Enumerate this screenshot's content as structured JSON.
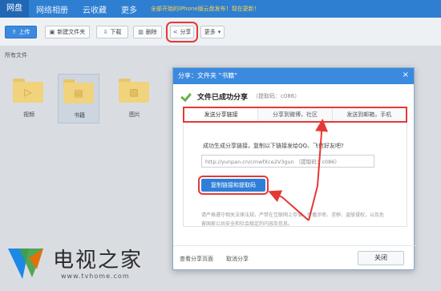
{
  "topbar": {
    "brand": "网盘",
    "nav": [
      "网络相册",
      "云收藏",
      "更多"
    ],
    "promo": "全部开始的iPhone版云盘发布！现在更新！"
  },
  "toolbar": {
    "upload": "上传",
    "new_folder": "新建文件夹",
    "download": "下载",
    "delete": "删除",
    "share": "分享",
    "more": "更多"
  },
  "breadcrumb": "所有文件",
  "files": [
    {
      "name": "视频",
      "icon": "play-icon"
    },
    {
      "name": "书籍",
      "icon": "book-icon"
    },
    {
      "name": "图片",
      "icon": "image-icon"
    }
  ],
  "dialog": {
    "title": "分享：文件夹 \"书籍\"",
    "success_title": "文件已成功分享",
    "extract_code": "（提取码：c086）",
    "tabs": [
      "发送分享链接",
      "分享到微博，社区",
      "发送到邮箱，手机"
    ],
    "instruction": "成功生成分享链接，复制以下链接发给QQ、飞信好友吧?",
    "link_value": "http://yunpan.cn/cmwfXce2V3gun （提取码：c086）",
    "copy_button": "复制链接和提取码",
    "notice": "请严格遵守相关法律法规，严禁在互联网上存储、传播涉密、淫秽、盗版侵权，以及危害国家公共安全和社会稳定的内容及信息。",
    "view_shared": "查看分享页面",
    "cancel_share": "取消分享",
    "close": "关闭"
  },
  "watermark": {
    "name": "电视之家",
    "url": "www.tvhome.com"
  },
  "colors": {
    "topbar": "#2e7fd2",
    "accent": "#3b8ae0",
    "annotation": "#e53935"
  }
}
